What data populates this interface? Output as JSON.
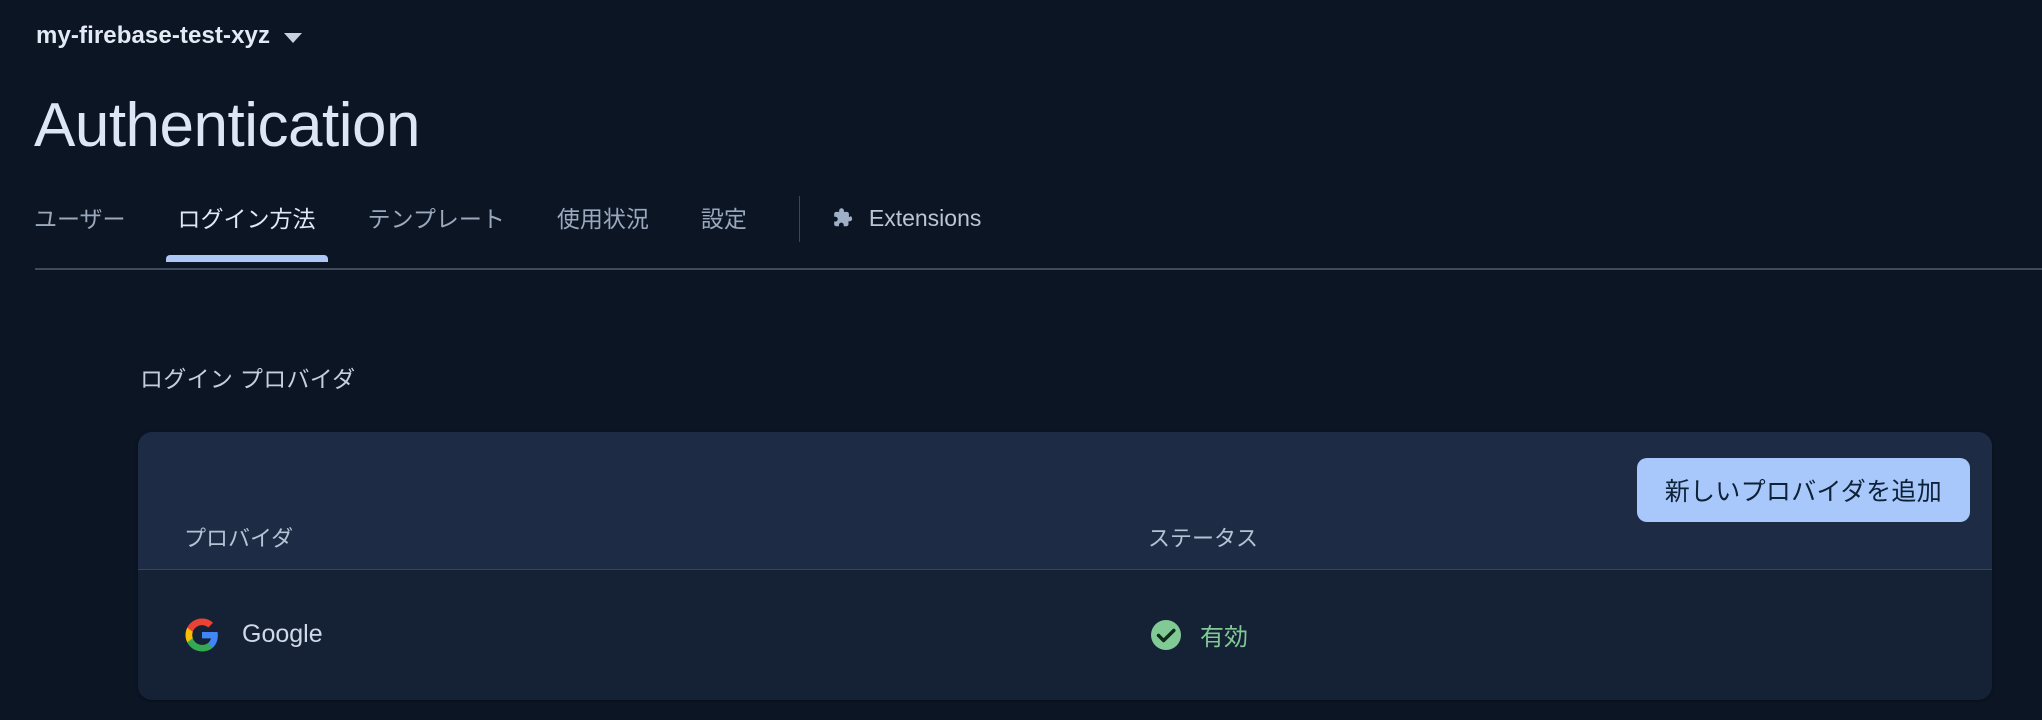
{
  "project": {
    "name": "my-firebase-test-xyz",
    "dropdown_icon": "chevron-down-icon"
  },
  "header": {
    "title": "Authentication"
  },
  "tabs": [
    {
      "label": "ユーザー",
      "active": false
    },
    {
      "label": "ログイン方法",
      "active": true
    },
    {
      "label": "テンプレート",
      "active": false
    },
    {
      "label": "使用状況",
      "active": false
    },
    {
      "label": "設定",
      "active": false
    }
  ],
  "extensions": {
    "label": "Extensions",
    "icon": "puzzle-piece-icon"
  },
  "main": {
    "section_label": "ログイン プロバイダ",
    "add_provider_label": "新しいプロバイダを追加",
    "table": {
      "columns": [
        "プロバイダ",
        "ステータス"
      ],
      "rows": [
        {
          "provider": "Google",
          "provider_icon": "google-g-icon",
          "status": "有効",
          "status_icon": "check-circle-icon"
        }
      ]
    }
  },
  "colors": {
    "page_background": "#0b1524",
    "card_header_background": "#1e2b44",
    "card_row_background": "#152235",
    "accent_button": "#a8c7fa",
    "active_tab_underline": "#aec8f5",
    "status_enabled": "#81c995"
  }
}
